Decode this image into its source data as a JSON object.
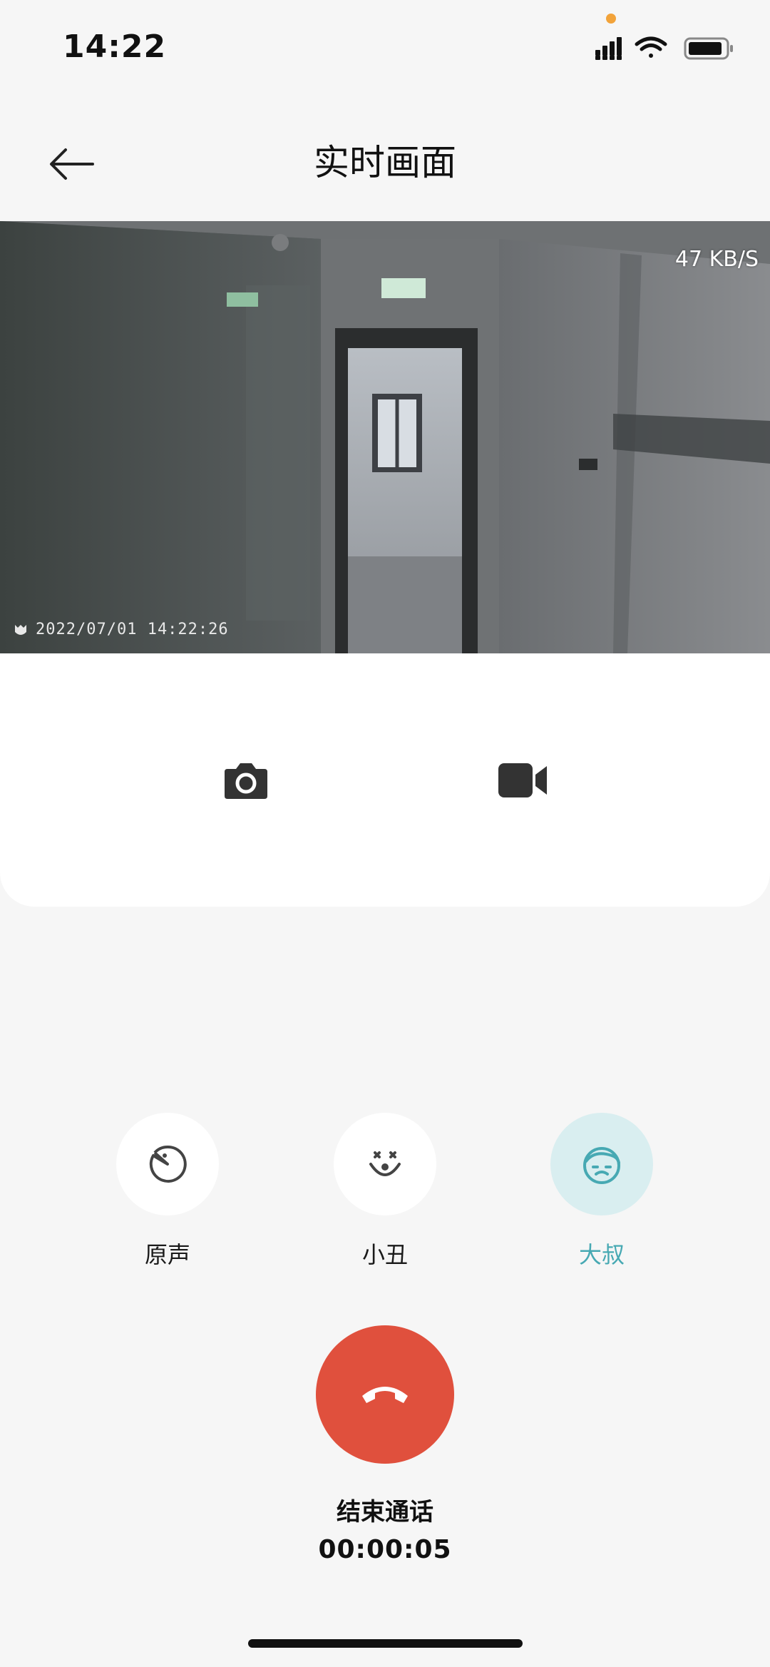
{
  "status_bar": {
    "time": "14:22"
  },
  "header": {
    "title": "实时画面"
  },
  "video": {
    "bitrate": "47 KB/S",
    "timestamp": "2022/07/01  14:22:26"
  },
  "controls": {
    "camera_icon": "camera-icon",
    "record_icon": "video-record-icon"
  },
  "voices": [
    {
      "label": "原声",
      "icon": "pacman-icon",
      "active": false
    },
    {
      "label": "小丑",
      "icon": "clown-face-icon",
      "active": false
    },
    {
      "label": "大叔",
      "icon": "uncle-face-icon",
      "active": true
    }
  ],
  "call": {
    "end_label": "结束通话",
    "duration": "00:00:05"
  },
  "colors": {
    "end_call": "#e0503d",
    "active_voice": "#47a9b3",
    "active_voice_bg": "#d9eef0"
  }
}
